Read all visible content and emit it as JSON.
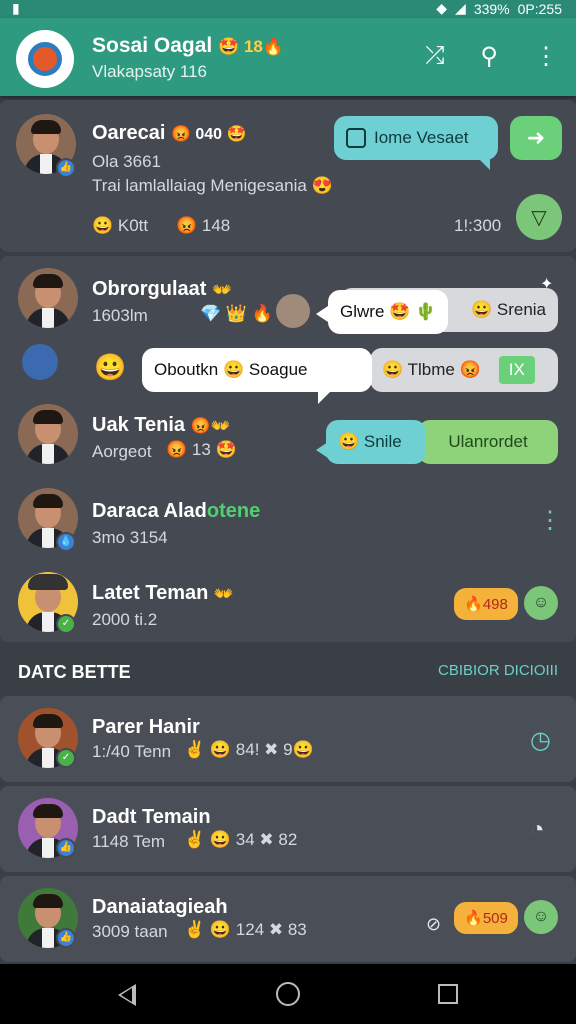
{
  "status_bar": {
    "left_icon": "bookmark-icon",
    "battery": "339%",
    "time": "0P:255"
  },
  "app_bar": {
    "title": "Sosai Oagal",
    "title_emoji": "🤩 18🔥",
    "subtitle": "Vlakapsaty 116",
    "actions": [
      "share-icon",
      "search-icon",
      "more-vert-icon"
    ]
  },
  "top_chat": {
    "name": "Oarecai",
    "name_suffix": "😡 040 🤩",
    "line1": "Ola 3661",
    "line2": "Trai lamlallaiag Menigesania 😍",
    "reactions": "😀 K0tt",
    "reactions2": "😡 148",
    "time": "1!:300",
    "bubble_text": "Iome Vesaet",
    "bubble_icon": "message-icon"
  },
  "group_chats": [
    {
      "name": "Obrorgulaat",
      "name_suffix": "👐",
      "sub": "1603lm",
      "sub_emoji": "💎 👑 🔥"
    },
    {
      "name": "Uak Tenia",
      "name_suffix": "😡👐",
      "sub": "Aorgeot",
      "sub_emoji": "😡 13 🤩"
    },
    {
      "name": "Daraca Alad",
      "name_suffix": "otene",
      "sub": "3mo 3154"
    },
    {
      "name": "Latet Teman",
      "name_suffix": "👐",
      "sub": "2000 ti.2"
    }
  ],
  "bubbles": {
    "b1": "Glwre 🤩 🌵",
    "b1_side": "😀 Srenia",
    "b2": "Oboutkn 😀 Soague",
    "b2_side": "😀 Tlbme 😡",
    "b2_badge": "IX",
    "b3": "😀 Snile",
    "b3_side": "Ulanrordet",
    "latet_tag": "🔥498"
  },
  "section": {
    "title": "DATC BETTE",
    "link": "CBIBIOR DICIOIII"
  },
  "recent": [
    {
      "name": "Parer Hanir",
      "sub": "1:/40 Tenn",
      "tail": "✌ 😀 84! ✖ 9😀",
      "action": "timer-icon"
    },
    {
      "name": "Dadt Temain",
      "sub": "1148 Tem",
      "tail": "✌ 😀 34 ✖ 82",
      "action": "clock-icon"
    },
    {
      "name": "Danaiatagieah",
      "sub": "3009 taan",
      "tail": "✌ 😀 124 ✖ 83",
      "action": "smile-icon",
      "tag": "🔥509"
    }
  ]
}
